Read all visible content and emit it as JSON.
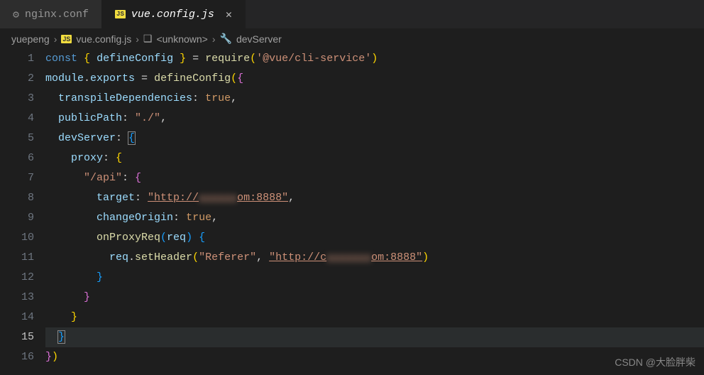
{
  "tabs": [
    {
      "label": "nginx.conf",
      "icon": "gear",
      "active": false
    },
    {
      "label": "vue.config.js",
      "icon": "js",
      "active": true
    }
  ],
  "breadcrumb": {
    "folder": "yuepeng",
    "file": "vue.config.js",
    "symbol1": "<unknown>",
    "symbol2": "devServer"
  },
  "lineNumbers": [
    "1",
    "2",
    "3",
    "4",
    "5",
    "6",
    "7",
    "8",
    "9",
    "10",
    "11",
    "12",
    "13",
    "14",
    "15",
    "16"
  ],
  "code": {
    "l1": {
      "const_kw": "const",
      "destruct": "defineConfig",
      "eq": " = ",
      "require": "require",
      "pkg": "'@vue/cli-service'"
    },
    "l2": {
      "module": "module",
      "dot": ".",
      "exports": "exports",
      "eq": " = ",
      "fn": "defineConfig"
    },
    "l3": {
      "key": "transpileDependencies",
      "val": "true"
    },
    "l4": {
      "key": "publicPath",
      "val": "\"./\""
    },
    "l5": {
      "key": "devServer"
    },
    "l6": {
      "key": "proxy"
    },
    "l7": {
      "key": "\"/api\""
    },
    "l8": {
      "key": "target",
      "pre": "\"http://",
      "blur": "xxxxxx",
      "post": "om:8888\""
    },
    "l9": {
      "key": "changeOrigin",
      "val": "true"
    },
    "l10": {
      "fn": "onProxyReq",
      "param": "req"
    },
    "l11": {
      "obj": "req",
      "method": "setHeader",
      "arg1": "\"Referer\"",
      "pre": "\"http://c",
      "blur": "xxxxxxx",
      "post": "om:8888\""
    }
  },
  "watermark": "CSDN @大脸胖柴"
}
